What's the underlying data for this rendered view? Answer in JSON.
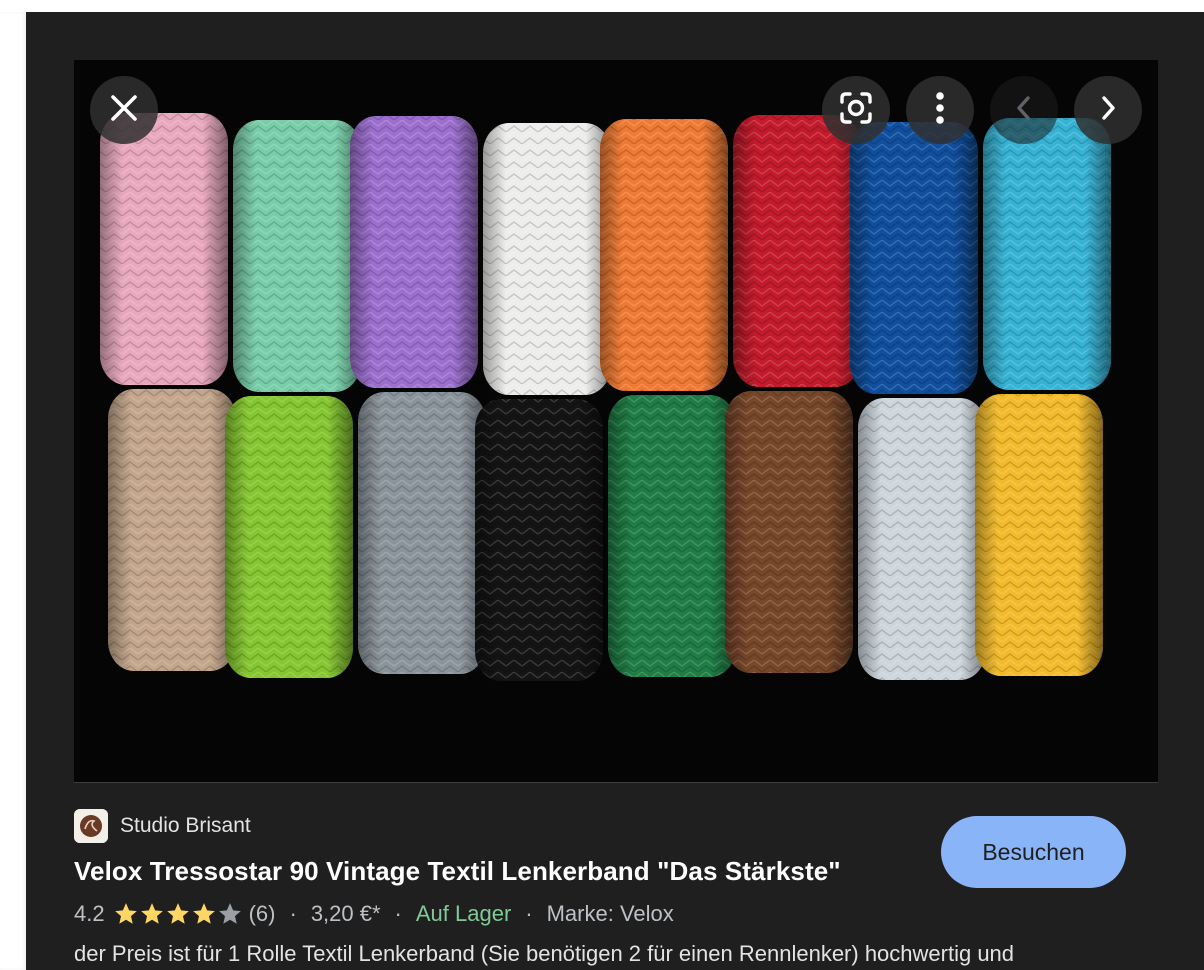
{
  "viewer": {
    "close_icon": "close-icon",
    "lens_icon": "google-lens-icon",
    "more_icon": "more-vert-icon",
    "prev_icon": "chevron-left-icon",
    "next_icon": "chevron-right-icon"
  },
  "image": {
    "top_row_colors": [
      "#e8a8bd",
      "#79cda9",
      "#9c6fcf",
      "#ededeb",
      "#ef7a33",
      "#c31b2c",
      "#104f9e",
      "#36b3d4"
    ],
    "bottom_row_colors": [
      "#c3a68b",
      "#86c631",
      "#8a949b",
      "#141414",
      "#1f7d45",
      "#77472a",
      "#cdd6dc",
      "#f2bb2c"
    ]
  },
  "result": {
    "source": "Studio Brisant",
    "title": "Velox Tressostar 90 Vintage Textil Lenkerband \"Das Stärkste\"",
    "rating": "4.2",
    "stars_filled": 4,
    "stars_total": 5,
    "review_count": "(6)",
    "price": "3,20 €*",
    "stock": "Auf Lager",
    "brand": "Marke: Velox",
    "description": "der Preis ist für 1 Rolle Textil Lenkerband (Sie benötigen 2 für einen Rennlenker) hochwertig und",
    "visit_label": "Besuchen"
  },
  "colors": {
    "accent": "#8ab4f8",
    "panel_bg": "#1f1f1f",
    "star": "#fdd663",
    "in_stock": "#81c995"
  }
}
